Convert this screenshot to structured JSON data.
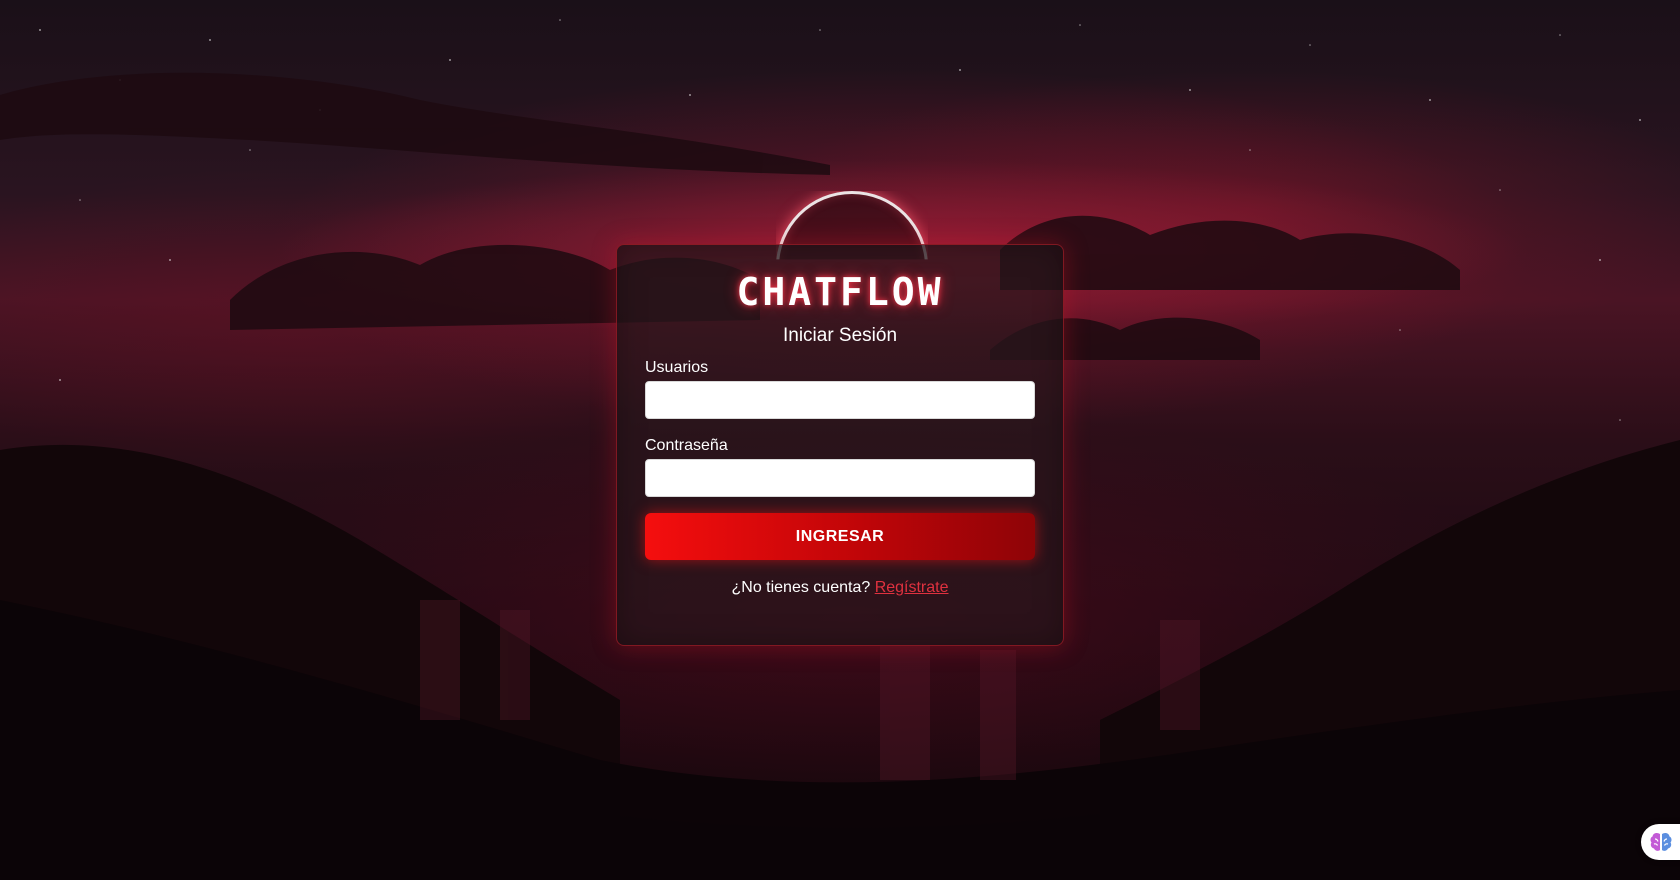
{
  "app": {
    "brand": "CHATFLOW",
    "subtitle": "Iniciar Sesión"
  },
  "form": {
    "username_label": "Usuarios",
    "username_value": "",
    "password_label": "Contraseña",
    "password_value": "",
    "submit_label": "INGRESAR",
    "register_prompt": "¿No tienes cuenta?",
    "register_link": "Regístrate"
  },
  "icons": {
    "assistant_fab": "brain-icon"
  },
  "colors": {
    "accent": "#e0313f",
    "button_start": "#f50e0e",
    "button_end": "#8e0407",
    "card_border": "#c81e28"
  }
}
